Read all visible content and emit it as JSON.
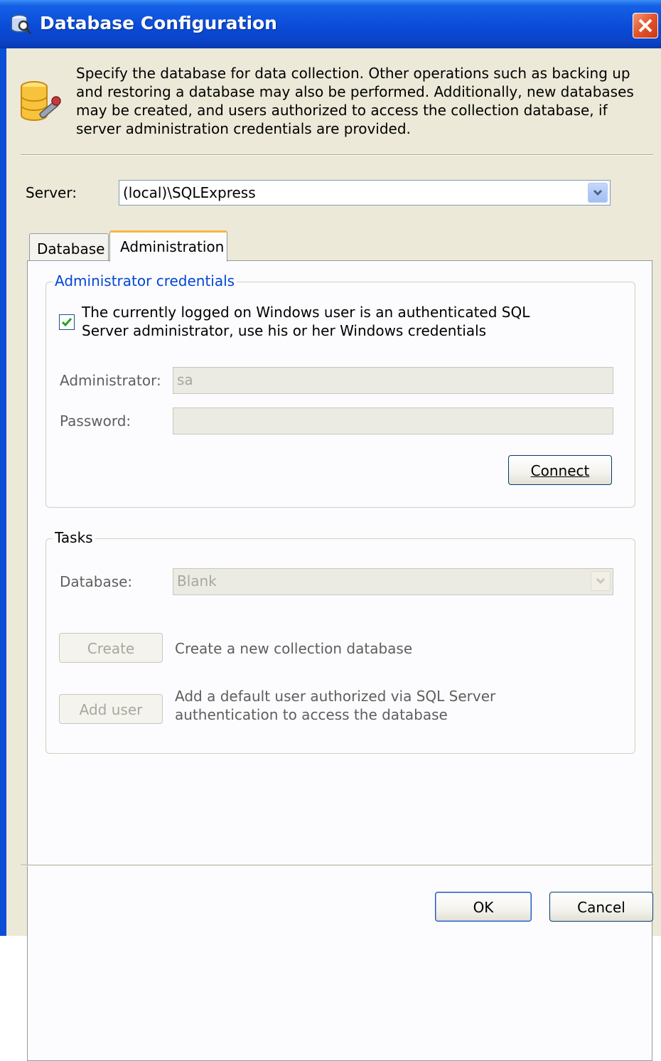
{
  "window": {
    "title": "Database Configuration"
  },
  "header": {
    "description": "Specify the database for data collection. Other operations such as backing up and restoring a database may also be performed.  Additionally, new databases may be created, and users authorized to access the collection database, if server administration credentials are provided."
  },
  "server": {
    "label": "Server:",
    "value": "(local)\\SQLExpress"
  },
  "tabs": [
    {
      "label": "Database",
      "active": false
    },
    {
      "label": "Administration",
      "active": true
    }
  ],
  "admin_credentials": {
    "title": "Administrator credentials",
    "use_windows_label": "The currently logged on Windows user is an authenticated SQL Server administrator, use his or her Windows credentials",
    "use_windows_checked": true,
    "administrator_label": "Administrator:",
    "administrator_value": "sa",
    "password_label": "Password:",
    "password_value": "",
    "connect_button": "Connect"
  },
  "tasks": {
    "title": "Tasks",
    "database_label": "Database:",
    "database_value": "Blank",
    "create_button": "Create",
    "create_description": "Create a new collection database",
    "add_user_button": "Add user",
    "add_user_description": "Add a default user authorized via SQL Server authentication to access the database"
  },
  "footer": {
    "ok_button": "OK",
    "cancel_button": "Cancel"
  },
  "colors": {
    "titlebar": "#0a4bd8",
    "dialog_bg": "#ece9d8",
    "group_title": "#0046d5",
    "close": "#e2532a",
    "tab_accent": "#f5b743"
  }
}
